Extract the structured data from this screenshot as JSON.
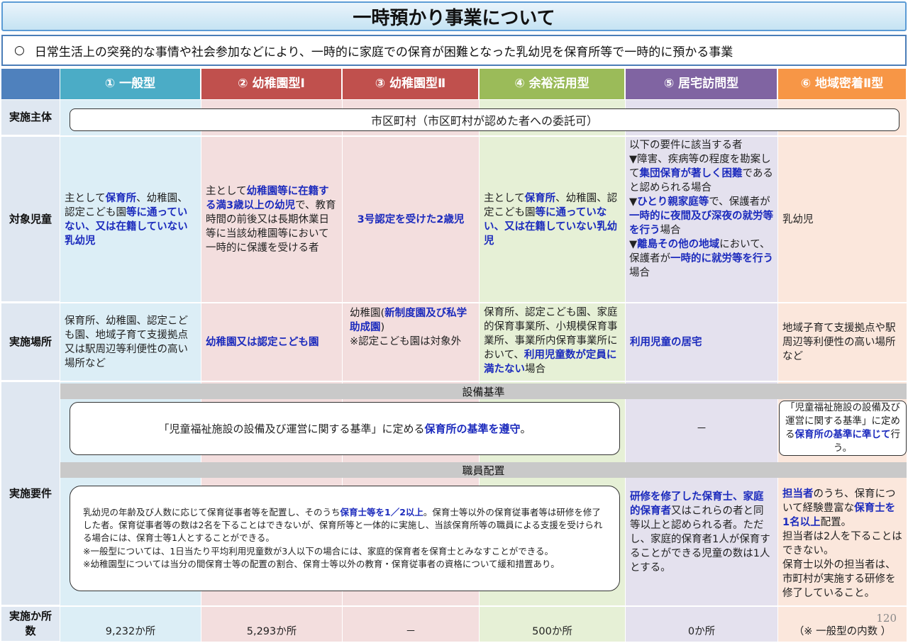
{
  "title": "一時預かり事業について",
  "intro": {
    "marker": "○",
    "text": "日常生活上の突発的な事情や社会参加などにより、一時的に家庭での保育が困難となった乳幼児を保育所等で一時的に預かる事業"
  },
  "colors": {
    "type1": "#4bacc6",
    "type2": "#c0504d",
    "type3": "#c0504d",
    "type4": "#9bbb59",
    "type5": "#8064a2",
    "type6": "#f79646",
    "label": "#4f81bd"
  },
  "headers": [
    "① 一般型",
    "② 幼稚園型Ⅰ",
    "③ 幼稚園型Ⅱ",
    "④ 余裕活用型",
    "⑤ 居宅訪問型",
    "⑥ 地域密着Ⅱ型"
  ],
  "row_labels": {
    "entity": "実施主体",
    "children": "対象児童",
    "place": "実施場所",
    "requirements": "実施要件",
    "count": "実施か所数"
  },
  "entity": "市区町村（市区町村が認めた者への委託可）",
  "children": {
    "c1": {
      "a": "主として",
      "b": "保育所",
      "c": "、幼稚園、認定こども園",
      "d": "等に通っていない、又は在籍していない乳幼児"
    },
    "c2": {
      "a": "主として",
      "b": "幼稚園等に在籍する満3歳以上の幼児",
      "c": "で、教育時間の前後又は長期休業日等に当該幼稚園等において一時的に保護を受ける者"
    },
    "c3": "3号認定を受けた2歳児",
    "c4": {
      "a": "主として",
      "b": "保育所",
      "c": "、幼稚園、認定こども園",
      "d": "等に通っていない、又は在籍していない乳幼児"
    },
    "c5": {
      "intro": "以下の要件に該当する者",
      "b1a": "▼障害、疾病等の程度を勘案して",
      "b1b": "集団保育が著しく困難",
      "b1c": "であると認められる場合",
      "b2a": "▼",
      "b2b": "ひとり親家庭等",
      "b2c": "で、保護者が",
      "b2d": "一時的に夜間及び深夜の就労等を行う",
      "b2e": "場合",
      "b3a": "▼",
      "b3b": "離島その他の地域",
      "b3c": "において、保護者が",
      "b3d": "一時的に就労等を行う",
      "b3e": "場合"
    },
    "c6": "乳幼児"
  },
  "place": {
    "c1": "保育所、幼稚園、認定こども園、地域子育て支援拠点又は駅周辺等利便性の高い場所など",
    "c2": "幼稚園又は認定こども園",
    "c3": {
      "a": "幼稚園(",
      "b": "新制度園及び私学助成園",
      "c": ")",
      "d": "※認定こども園は対象外"
    },
    "c4": {
      "a": "保育所、認定こども園、家庭的保育事業所、小規模保育事業所、事業所内保育事業所において、",
      "b": "利用児童数が定員に満たない",
      "c": "場合"
    },
    "c5": "利用児童の居宅",
    "c6": "地域子育て支援拠点や駅周辺等利便性の高い場所など"
  },
  "requirements": {
    "facility_label": "設備基準",
    "facility_main": {
      "a": "「児童福祉施設の設備及び運営に関する基準」に定める",
      "b": "保育所の基準を遵守",
      "c": "。"
    },
    "facility_c5": "－",
    "facility_c6": {
      "a": "「児童福祉施設の設備及び運営に関する基準」に定める",
      "b": "保育所の基準に準じて",
      "c": "行う。"
    },
    "staff_label": "職員配置",
    "staff_main": {
      "a": "乳幼児の年齢及び人数に応じて保育従事者等を配置し、そのうち",
      "b": "保育士等を1／2以上",
      "c": "。保育士等以外の保育従事者等は研修を修了した者。保育従事者等の数は2名を下ることはできないが、保育所等と一体的に実施し、当該保育所等の職員による支援を受けられる場合には、保育士等1人とすることができる。",
      "d": "※一般型については、1日当たり平均利用児童数が3人以下の場合には、家庭的保育者を保育士とみなすことができる。",
      "e": "※幼稚園型については当分の間保育士等の配置の割合、保育士等以外の教育・保育従事者の資格について緩和措置あり。"
    },
    "staff_c5": {
      "a": "研修を修了した保育士、家庭的保育者",
      "b": "又はこれらの者と同等以上と認められる者。ただし、家庭的保育者1人が保育することができる児童の数は1人とする。"
    },
    "staff_c6": {
      "a": "担当者",
      "b": "のうち、保育について経験豊富な",
      "c": "保育士を1名以上",
      "d": "配置。",
      "e": "担当者は2人を下ることはできない。",
      "f": "保育士以外の担当者は、市町村が実施する研修を修了していること。"
    }
  },
  "counts": [
    "9,232か所",
    "5,293か所",
    "－",
    "500か所",
    "0か所",
    "（※ 一般型の内数 ）"
  ],
  "page_number": "120"
}
